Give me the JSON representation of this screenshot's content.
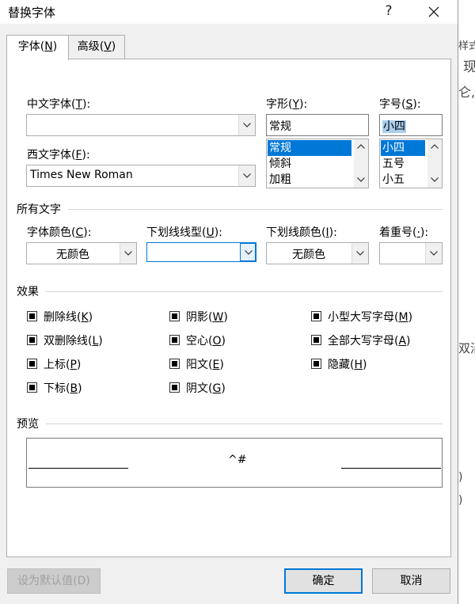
{
  "window": {
    "title": "替换字体",
    "help_label": "?",
    "close_label": "✕"
  },
  "tabs": [
    {
      "label_pre": "字体(",
      "key": "N",
      "label_post": ")"
    },
    {
      "label_pre": "高级(",
      "key": "V",
      "label_post": ")"
    }
  ],
  "chinese_font": {
    "label_pre": "中文字体(",
    "key": "T",
    "label_post": "):",
    "value": ""
  },
  "western_font": {
    "label_pre": "西文字体(",
    "key": "F",
    "label_post": "):",
    "value": "Times New Roman"
  },
  "font_style": {
    "label_pre": "字形(",
    "key": "Y",
    "label_post": "):",
    "value": "常规",
    "options": [
      "常规",
      "倾斜",
      "加粗"
    ],
    "selected": "常规"
  },
  "font_size": {
    "label_pre": "字号(",
    "key": "S",
    "label_post": "):",
    "value": "小四",
    "options": [
      "小四",
      "五号",
      "小五"
    ],
    "selected": "小四"
  },
  "all_text": {
    "section_label": "所有文字",
    "font_color": {
      "label_pre": "字体颜色(",
      "key": "C",
      "label_post": "):",
      "value": "无颜色"
    },
    "underline_style": {
      "label_pre": "下划线线型(",
      "key": "U",
      "label_post": "):",
      "value": ""
    },
    "underline_color": {
      "label_pre": "下划线颜色(",
      "key": "I",
      "label_post": "):",
      "value": "无颜色"
    },
    "emphasis": {
      "label_pre": "着重号(",
      "key": "·",
      "label_post": "):",
      "value": ""
    }
  },
  "effects": {
    "section_label": "效果",
    "items": [
      {
        "pre": "删除线(",
        "key": "K",
        "post": ")"
      },
      {
        "pre": "双删除线(",
        "key": "L",
        "post": ")"
      },
      {
        "pre": "上标(",
        "key": "P",
        "post": ")"
      },
      {
        "pre": "下标(",
        "key": "B",
        "post": ")"
      },
      {
        "pre": "阴影(",
        "key": "W",
        "post": ")"
      },
      {
        "pre": "空心(",
        "key": "O",
        "post": ")"
      },
      {
        "pre": "阳文(",
        "key": "E",
        "post": ")"
      },
      {
        "pre": "阴文(",
        "key": "G",
        "post": ")"
      },
      {
        "pre": "小型大写字母(",
        "key": "M",
        "post": ")"
      },
      {
        "pre": "全部大写字母(",
        "key": "A",
        "post": ")"
      },
      {
        "pre": "隐藏(",
        "key": "H",
        "post": ")"
      }
    ]
  },
  "preview": {
    "section_label": "预览",
    "sample_text": "^#"
  },
  "buttons": {
    "set_default": "设为默认值(D)",
    "ok": "确定",
    "cancel": "取消"
  },
  "background_doc": {
    "fragments": [
      "样式",
      "现",
      "仑,",
      "双消",
      ")",
      ")"
    ]
  },
  "colors": {
    "dialog_bg": "#f0f0f0",
    "selection": "#0078d7",
    "edit_selection": "#aacfee"
  }
}
